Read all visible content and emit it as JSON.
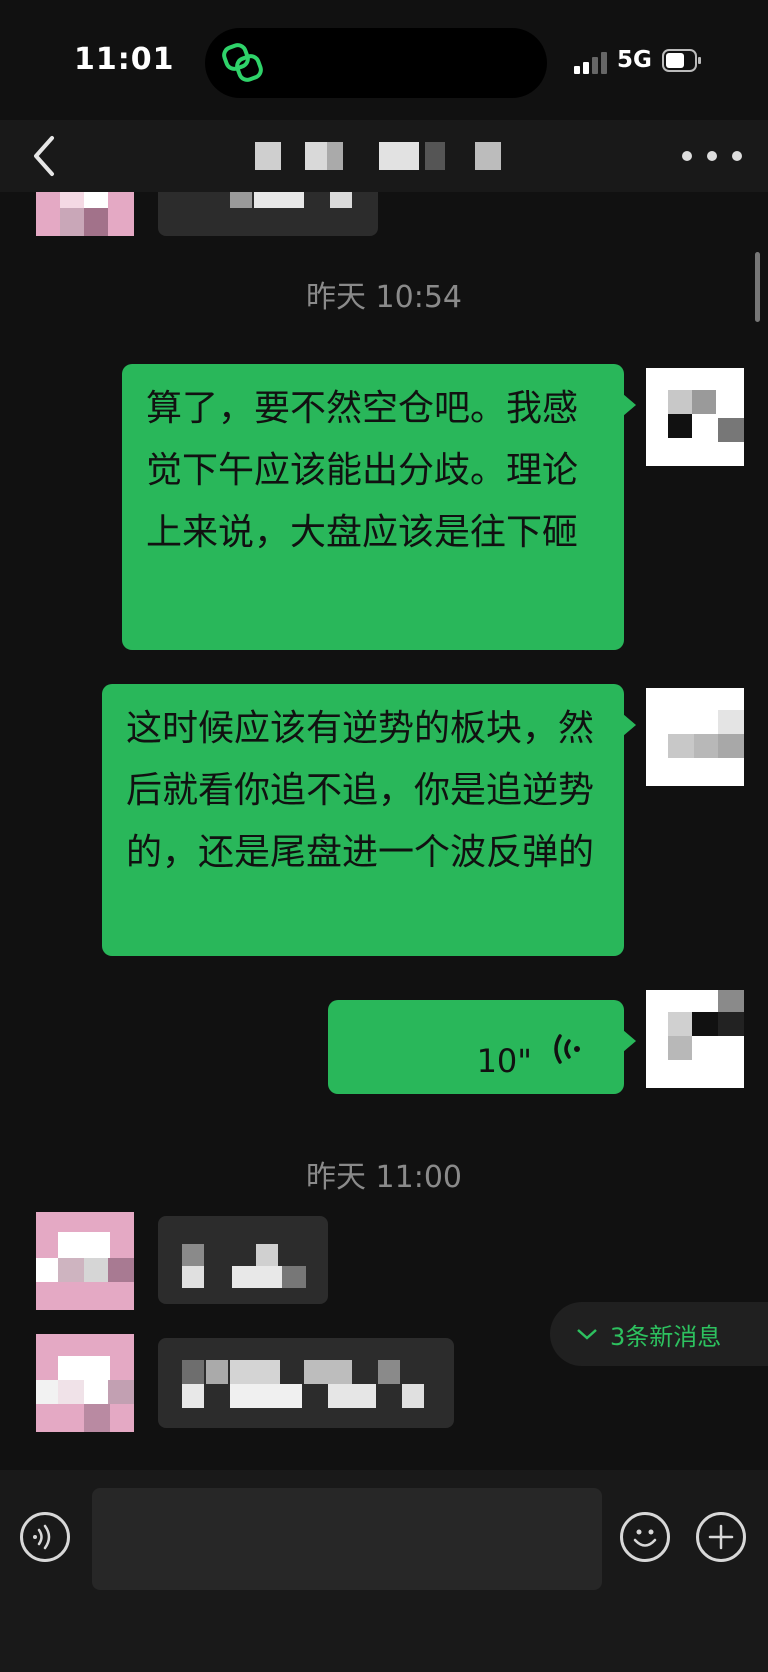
{
  "status_bar": {
    "time": "11:01",
    "network": "5G"
  },
  "nav": {
    "title": ""
  },
  "chat": {
    "timestamps": [
      "昨天 10:54",
      "昨天 11:00"
    ],
    "messages": [
      {
        "text": "算了，要不然空仓吧。我感觉下午应该能出分歧。理论上来说，大盘应该是往下砸"
      },
      {
        "text": "这时候应该有逆势的板块，然后就看你追不追，你是追逆势的，还是尾盘进一个波反弹的"
      },
      {
        "voice_duration": "10\""
      }
    ],
    "new_messages_badge": "3条新消息"
  },
  "colors": {
    "bubble_out": "#29b75a",
    "accent": "#2dc15f",
    "background": "#111111"
  },
  "icons": {
    "back": "chevron-left-icon",
    "more": "more-dots-icon",
    "voice_mode": "voice-mode-icon",
    "emoji": "emoji-icon",
    "add": "add-icon",
    "voice_wave": "voice-wave-icon"
  }
}
